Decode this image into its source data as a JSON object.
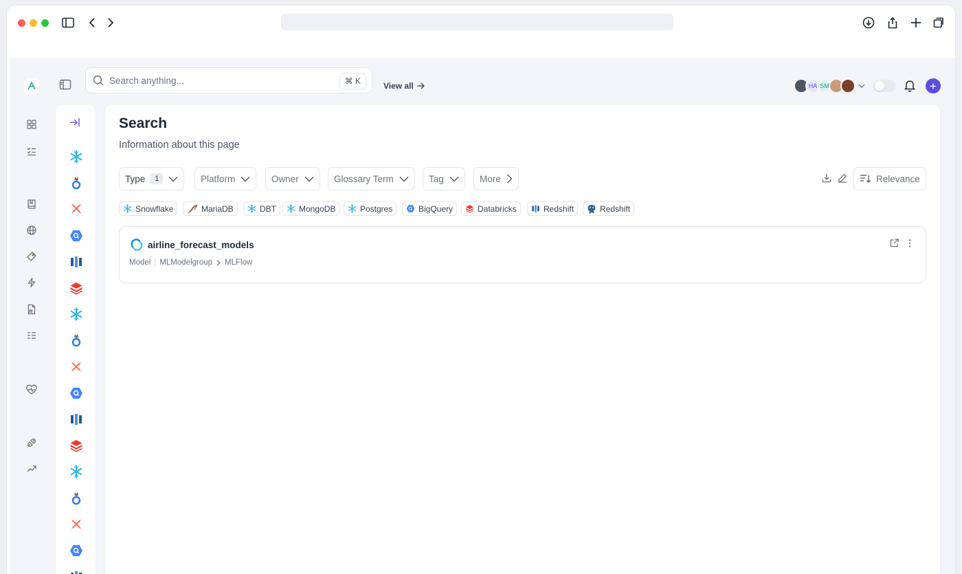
{
  "search": {
    "placeholder": "Search anything...",
    "shortcut": "⌘ K",
    "view_all": "View all"
  },
  "avatars": [
    {
      "initials": "",
      "color": "#4b5563"
    },
    {
      "initials": "HA",
      "color": "#e9e7fb"
    },
    {
      "initials": "SM",
      "color": "#dff4f2"
    },
    {
      "initials": "",
      "color": "#c89b7b"
    },
    {
      "initials": "",
      "color": "#7a3f2d"
    }
  ],
  "page": {
    "title": "Search",
    "subtitle": "Information about this page"
  },
  "filters": {
    "type": {
      "label": "Type",
      "count": "1"
    },
    "platform": "Platform",
    "owner": "Owner",
    "glossary": "Glossary Term",
    "tag": "Tag",
    "more": "More",
    "sort": "Relevance"
  },
  "platform_chips": [
    "Snowflake",
    "MariaDB",
    "DBT",
    "MongoDB",
    "Postgres",
    "BigQuery",
    "Databricks",
    "Redshift",
    "Redshift"
  ],
  "result": {
    "name": "airline_forecast_models",
    "crumb_type": "Model",
    "crumb_group": "MLModelgroup",
    "crumb_platform": "MLFlow"
  },
  "colors": {
    "accent": "#5b4fe0",
    "snowflake": "#29b5e8",
    "dbt": "#ff694a",
    "bigquery": "#4285f4",
    "redshift": "#205b98",
    "databricks": "#ef3b2c"
  }
}
